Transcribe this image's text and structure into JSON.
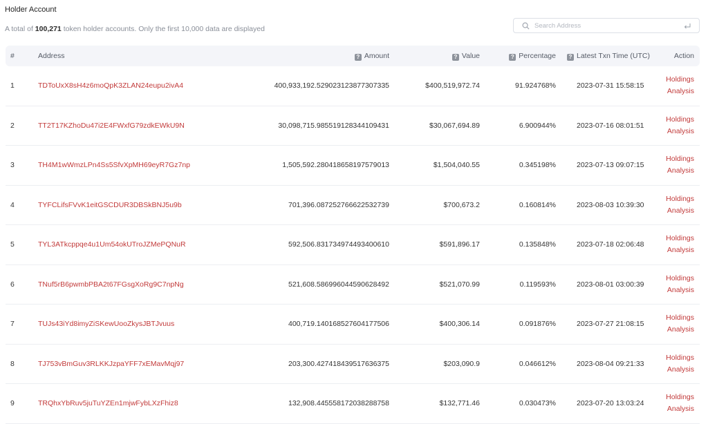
{
  "header": {
    "title": "Holder Account",
    "summary_prefix": "A total of",
    "summary_count": "100,271",
    "summary_suffix": "token holder accounts. Only the first 10,000 data are displayed"
  },
  "search": {
    "placeholder": "Search Address"
  },
  "table": {
    "columns": {
      "index": "#",
      "address": "Address",
      "amount": "Amount",
      "value": "Value",
      "percentage": "Percentage",
      "time": "Latest Txn Time (UTC)",
      "action": "Action"
    },
    "help_glyph": "?",
    "rows": [
      {
        "index": "1",
        "address": "TDToUxX8sH4z6moQpK3ZLAN24eupu2ivA4",
        "amount": "400,933,192.529023123877307335",
        "value": "$400,519,972.74",
        "percentage": "91.924768%",
        "time": "2023-07-31 15:58:15",
        "action1": "Holdings",
        "action2": "Analysis"
      },
      {
        "index": "2",
        "address": "TT2T17KZhoDu47i2E4FWxfG79zdkEWkU9N",
        "amount": "30,098,715.985519128344109431",
        "value": "$30,067,694.89",
        "percentage": "6.900944%",
        "time": "2023-07-16 08:01:51",
        "action1": "Holdings",
        "action2": "Analysis"
      },
      {
        "index": "3",
        "address": "TH4M1wWmzLPn4Ss5SfvXpMH69eyR7Gz7np",
        "amount": "1,505,592.280418658197579013",
        "value": "$1,504,040.55",
        "percentage": "0.345198%",
        "time": "2023-07-13 09:07:15",
        "action1": "Holdings",
        "action2": "Analysis"
      },
      {
        "index": "4",
        "address": "TYFCLifsFVvK1eitGSCDUR3DBSkBNJ5u9b",
        "amount": "701,396.087252766622532739",
        "value": "$700,673.2",
        "percentage": "0.160814%",
        "time": "2023-08-03 10:39:30",
        "action1": "Holdings",
        "action2": "Analysis"
      },
      {
        "index": "5",
        "address": "TYL3ATkcppqe4u1Um54okUTroJZMePQNuR",
        "amount": "592,506.831734974493400610",
        "value": "$591,896.17",
        "percentage": "0.135848%",
        "time": "2023-07-18 02:06:48",
        "action1": "Holdings",
        "action2": "Analysis"
      },
      {
        "index": "6",
        "address": "TNuf5rB6pwmbPBA2t67FGsgXoRg9C7npNg",
        "amount": "521,608.586996044590628492",
        "value": "$521,070.99",
        "percentage": "0.119593%",
        "time": "2023-08-01 03:00:39",
        "action1": "Holdings",
        "action2": "Analysis"
      },
      {
        "index": "7",
        "address": "TUJs43iYd8imyZiSKewUooZkysJBTJvuus",
        "amount": "400,719.140168527604177506",
        "value": "$400,306.14",
        "percentage": "0.091876%",
        "time": "2023-07-27 21:08:15",
        "action1": "Holdings",
        "action2": "Analysis"
      },
      {
        "index": "8",
        "address": "TJ753vBmGuv3RLKKJzpaYFF7xEMavMqj97",
        "amount": "203,300.427418439517636375",
        "value": "$203,090.9",
        "percentage": "0.046612%",
        "time": "2023-08-04 09:21:33",
        "action1": "Holdings",
        "action2": "Analysis"
      },
      {
        "index": "9",
        "address": "TRQhxYbRuv5juTuYZEn1mjwFybLXzFhiz8",
        "amount": "132,908.445558172038288758",
        "value": "$132,771.46",
        "percentage": "0.030473%",
        "time": "2023-07-20 13:03:24",
        "action1": "Holdings",
        "action2": "Analysis"
      }
    ]
  },
  "colors": {
    "link": "#c23a3a",
    "header_bg": "#f4f5f9",
    "muted_text": "#8a8f99"
  }
}
